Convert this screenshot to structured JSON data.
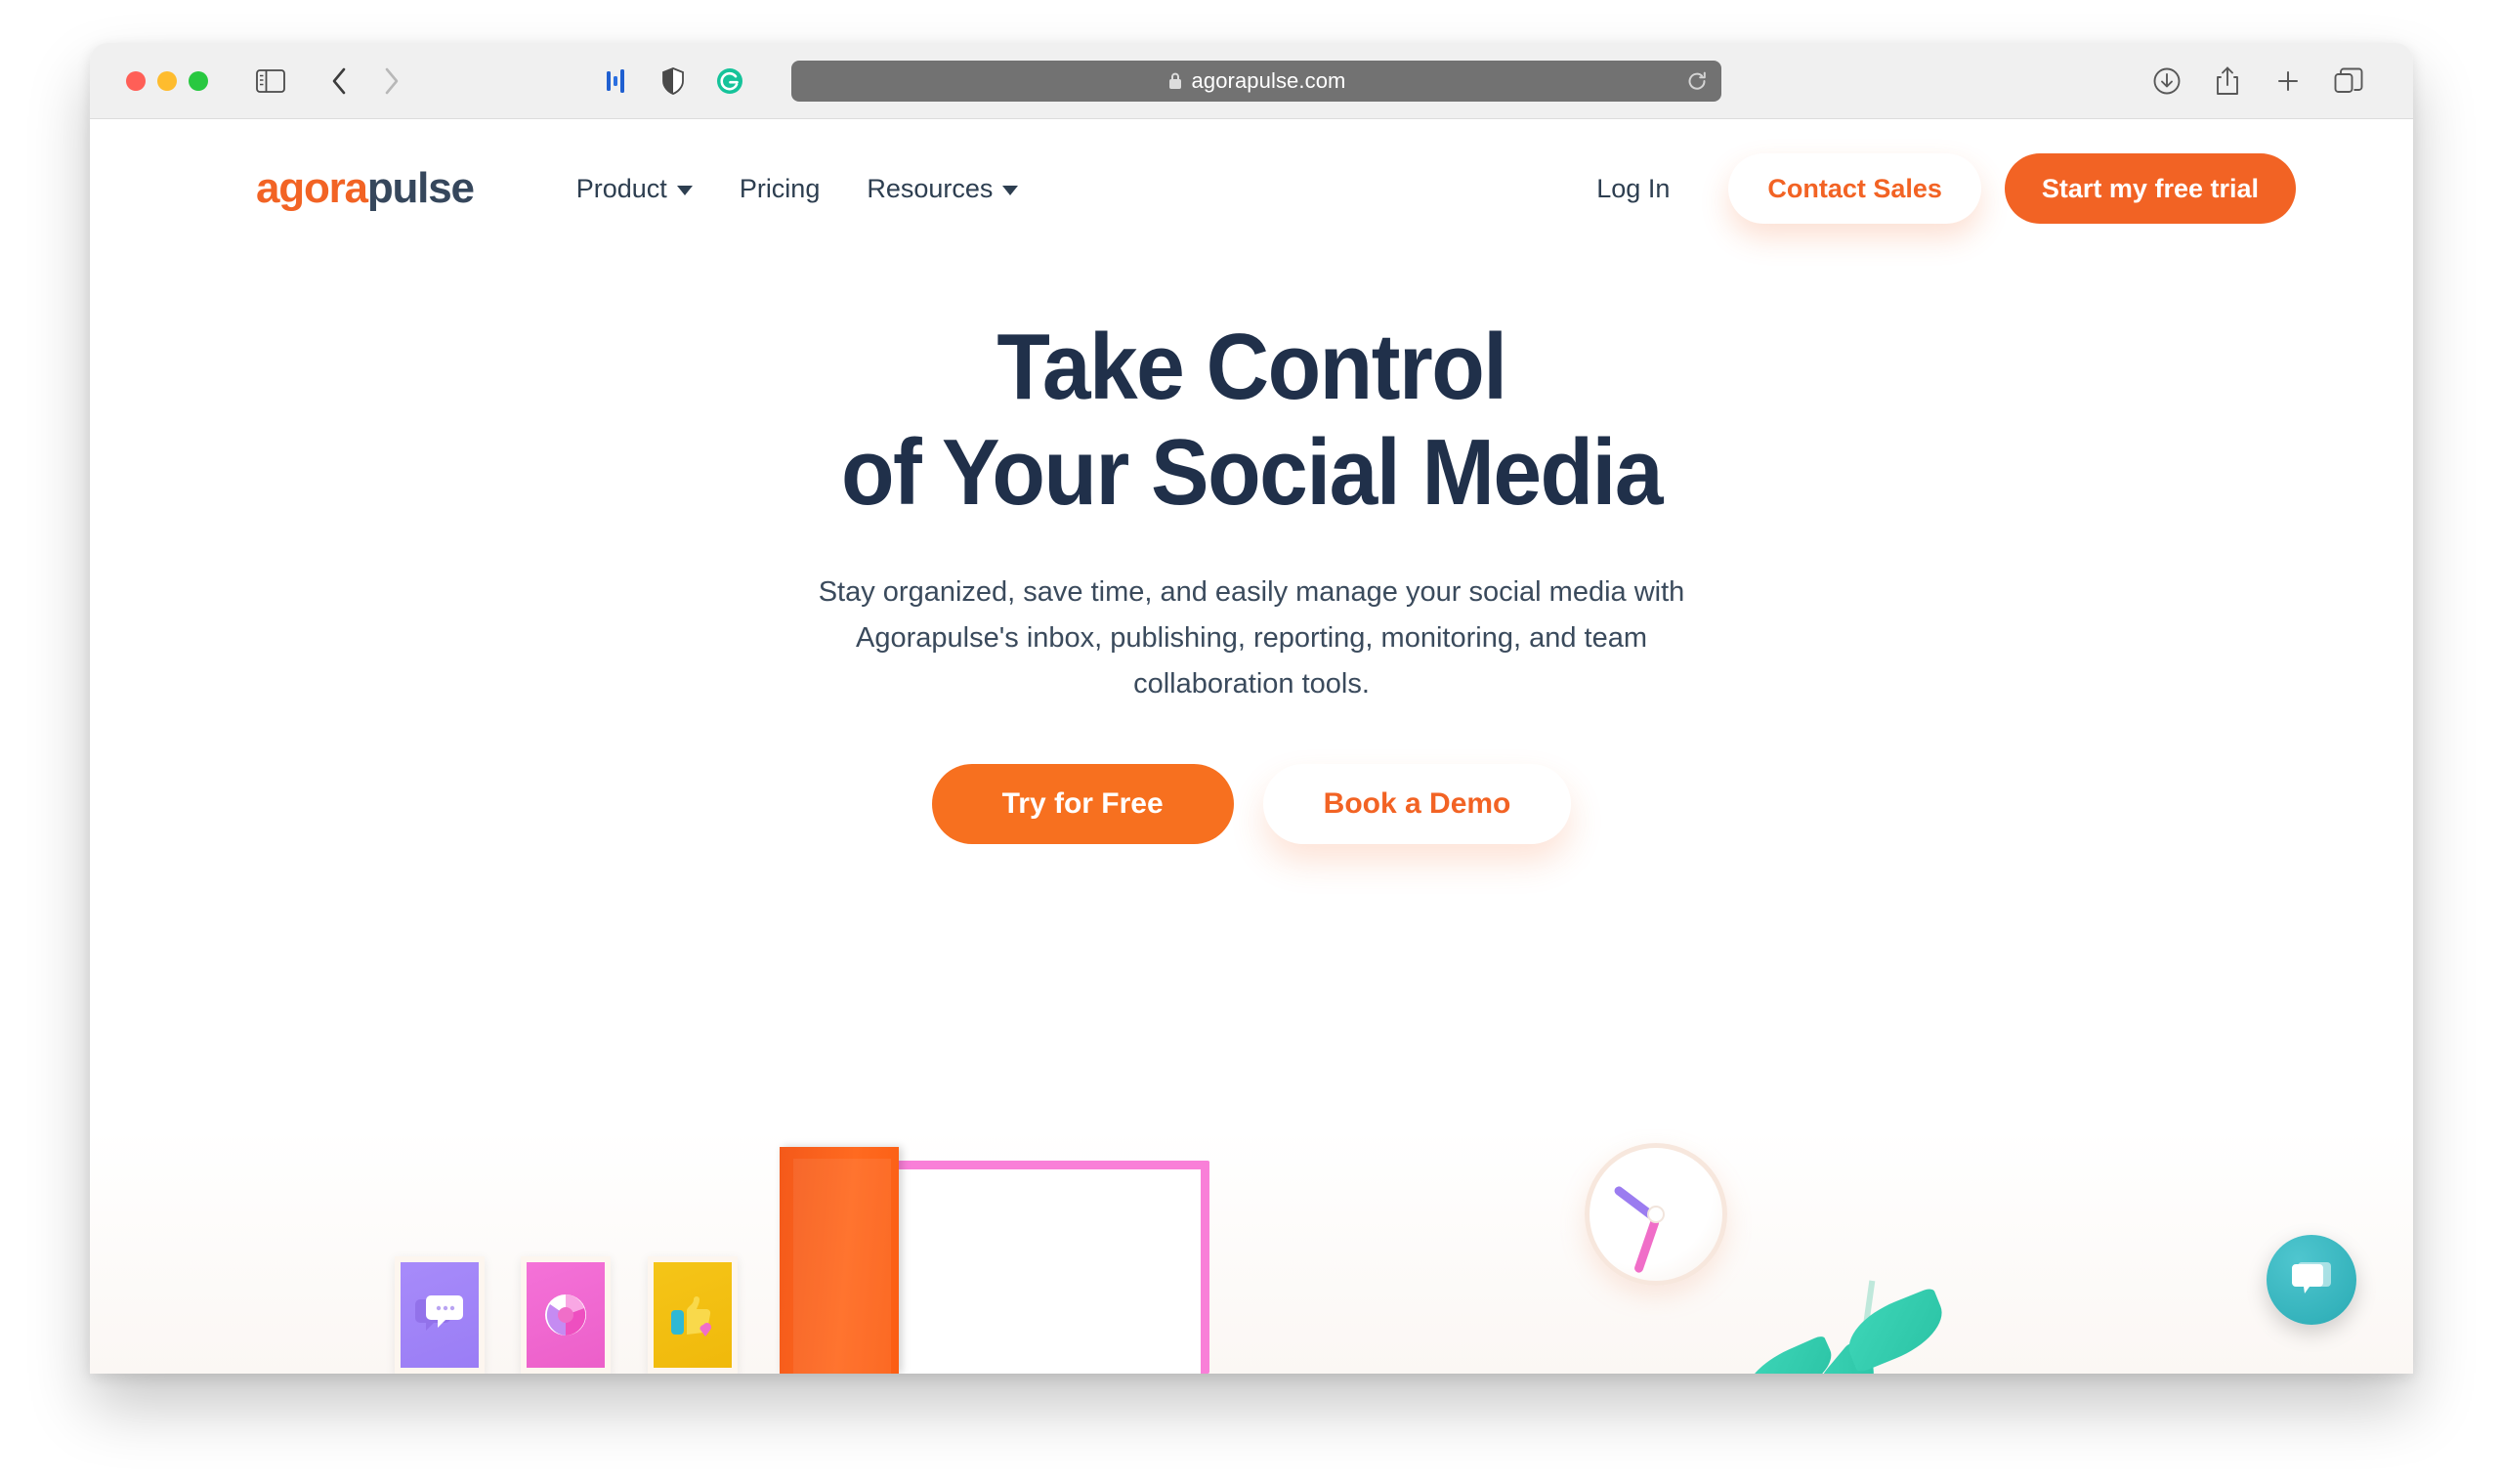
{
  "browser": {
    "app": "Safari",
    "traffic_lights": [
      "close",
      "minimize",
      "zoom"
    ],
    "url": "agorapulse.com",
    "url_secure": true,
    "toolbar_icons": [
      "sidebar-icon",
      "back-arrow-icon",
      "forward-arrow-icon",
      "extension-bars-icon",
      "shield-icon",
      "grammarly-icon",
      "reload-icon",
      "downloads-icon",
      "share-icon",
      "new-tab-icon",
      "tab-overview-icon"
    ]
  },
  "site": {
    "logo": {
      "part1": "agora",
      "part2": "pulse"
    },
    "nav": [
      {
        "label": "Product",
        "has_dropdown": true
      },
      {
        "label": "Pricing",
        "has_dropdown": false
      },
      {
        "label": "Resources",
        "has_dropdown": true
      }
    ],
    "login_label": "Log In",
    "contact_sales_label": "Contact Sales",
    "free_trial_label": "Start my free trial"
  },
  "hero": {
    "title_line1": "Take Control",
    "title_line2": "of Your Social Media",
    "subtitle": "Stay organized, save time, and easily manage your social media with Agorapulse's inbox, publishing, reporting, monitoring, and team collaboration tools.",
    "cta_primary": "Try for Free",
    "cta_secondary": "Book a Demo"
  },
  "illustration": {
    "posters": [
      {
        "name": "speech-bubbles-poster",
        "color": "#a78bfa"
      },
      {
        "name": "pie-chart-poster",
        "color": "#f472d8"
      },
      {
        "name": "thumbs-up-poster",
        "color": "#f5c518"
      }
    ],
    "door_color": "#f4591a",
    "door_frame_color": "#f97fd8",
    "clock": {
      "hour_hand_color": "#9b7cf0",
      "minute_hand_color": "#f06ec8"
    },
    "plant_color": "#3ed6b8"
  },
  "chat": {
    "label": "chat-widget",
    "color": "#35b3bc"
  },
  "colors": {
    "brand_orange": "#f26324",
    "brand_navy": "#20304a",
    "cta_orange": "#f7701f",
    "toolbar_gray": "#f0f0f0",
    "address_bar_gray": "#727272"
  }
}
